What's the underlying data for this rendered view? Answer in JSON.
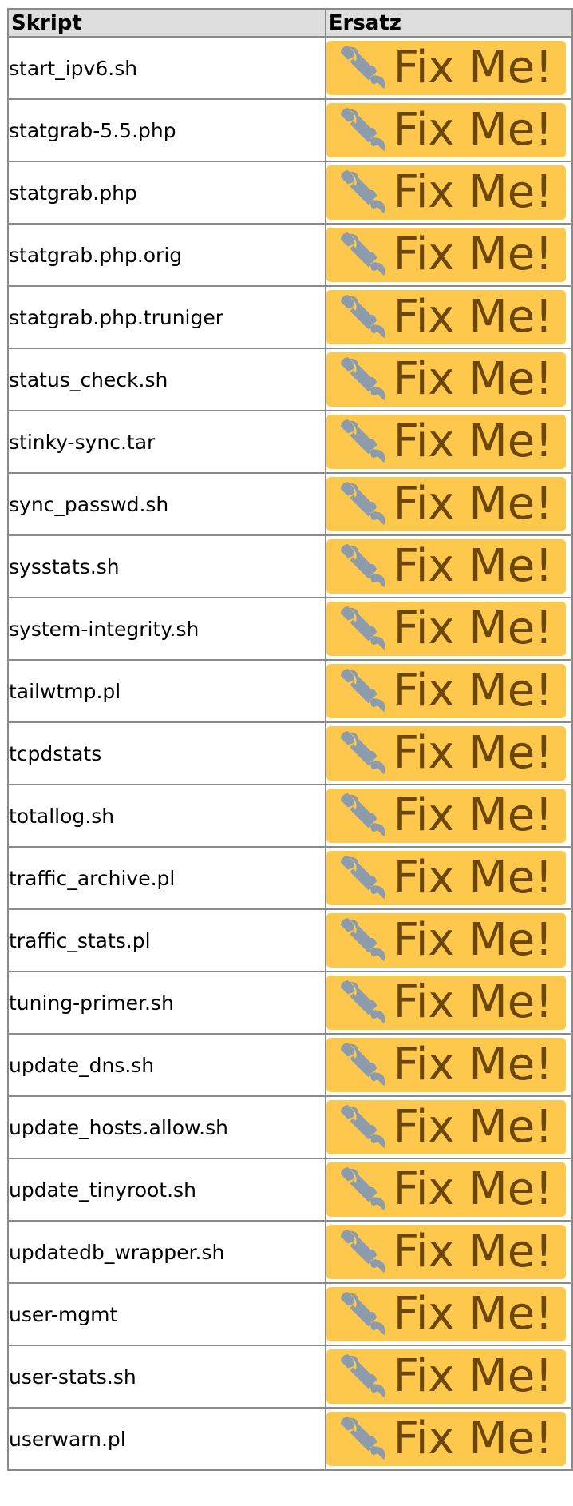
{
  "table": {
    "headers": {
      "script": "Skript",
      "replacement": "Ersatz"
    },
    "fixme_label": "Fix Me!",
    "fixme_icon": "wrench-icon",
    "colors": {
      "badge_bg": "#fec84d",
      "badge_text": "#6b4606",
      "wrench": "#8d9cac",
      "header_bg": "#dedede",
      "border": "#8a8a8a"
    },
    "rows": [
      {
        "name": "start_ipv6.sh"
      },
      {
        "name": "statgrab-5.5.php"
      },
      {
        "name": "statgrab.php"
      },
      {
        "name": "statgrab.php.orig"
      },
      {
        "name": "statgrab.php.truniger"
      },
      {
        "name": "status_check.sh"
      },
      {
        "name": "stinky-sync.tar"
      },
      {
        "name": "sync_passwd.sh"
      },
      {
        "name": "sysstats.sh"
      },
      {
        "name": "system-integrity.sh"
      },
      {
        "name": "tailwtmp.pl"
      },
      {
        "name": "tcpdstats"
      },
      {
        "name": "totallog.sh"
      },
      {
        "name": "traffic_archive.pl"
      },
      {
        "name": "traffic_stats.pl"
      },
      {
        "name": "tuning-primer.sh"
      },
      {
        "name": "update_dns.sh"
      },
      {
        "name": "update_hosts.allow.sh"
      },
      {
        "name": "update_tinyroot.sh"
      },
      {
        "name": "updatedb_wrapper.sh"
      },
      {
        "name": "user-mgmt"
      },
      {
        "name": "user-stats.sh"
      },
      {
        "name": "userwarn.pl"
      }
    ]
  }
}
